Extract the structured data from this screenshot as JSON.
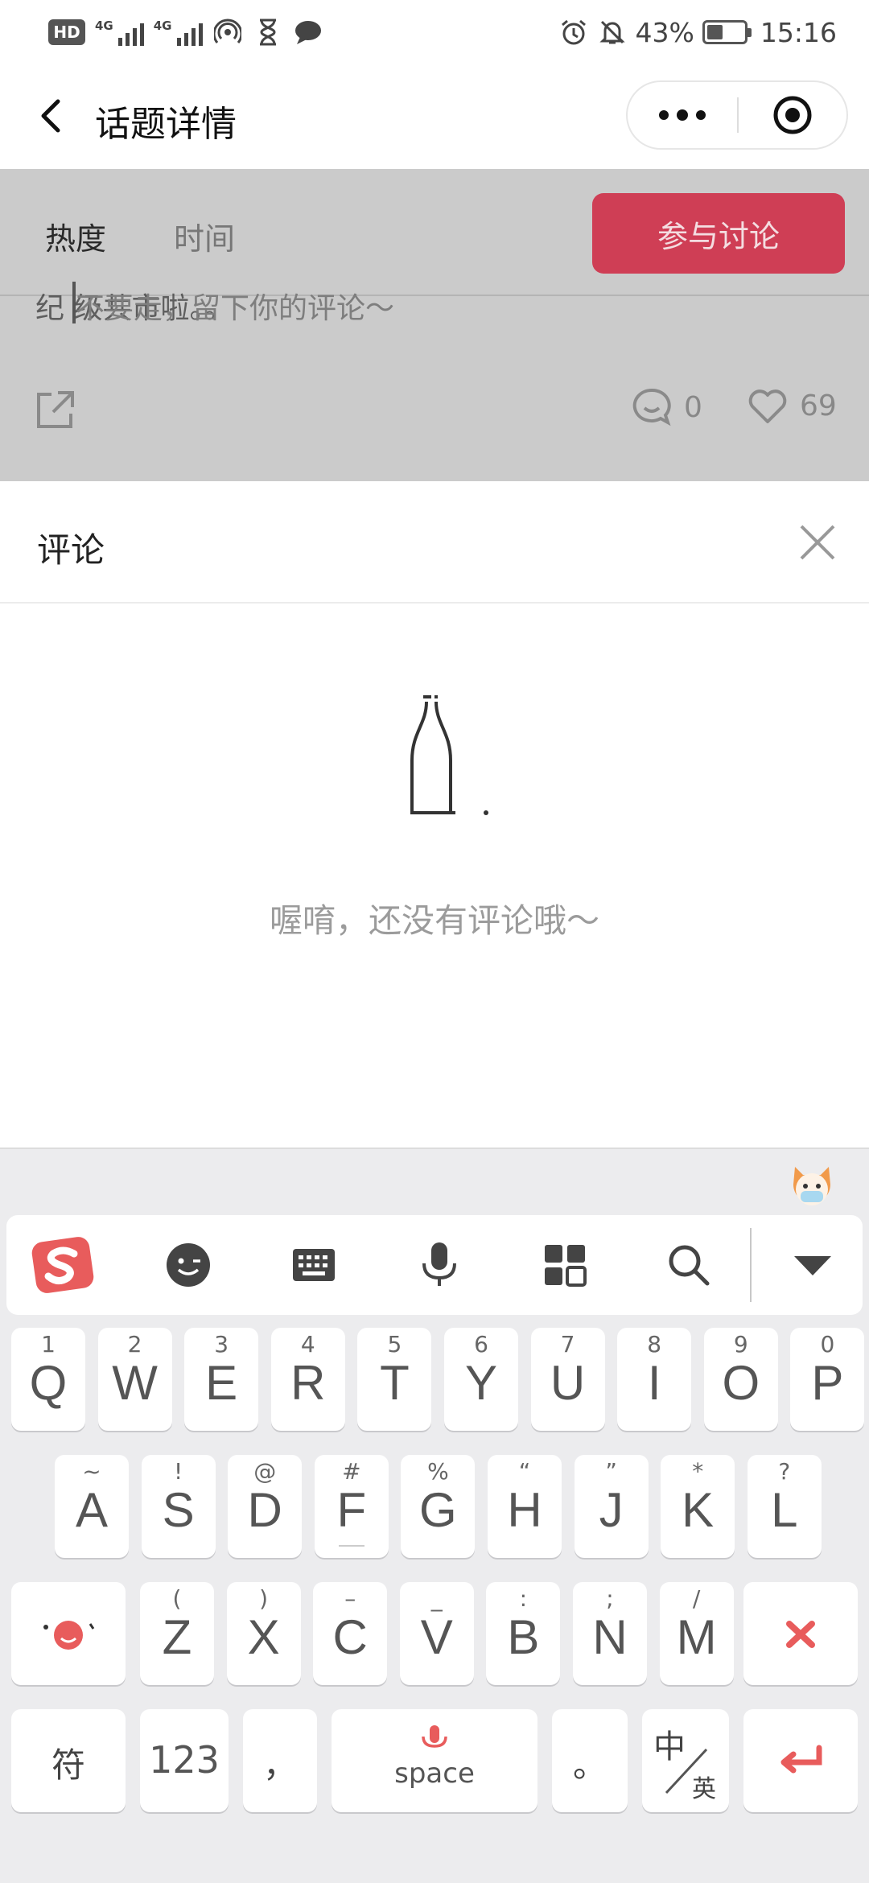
{
  "status": {
    "network_1": "4G",
    "network_2": "4G",
    "battery": "43%",
    "battery_level": 0.43,
    "time": "15:16"
  },
  "header": {
    "title": "话题详情"
  },
  "content": {
    "tab_hot": "热度",
    "tab_time": "时间",
    "join_button": "参与讨论",
    "overlap_text": "纪 级共市啦。。",
    "comment_hint": "不要走，留下你的评论～",
    "comment_count": "0",
    "like_count": "69"
  },
  "comments": {
    "title": "评论",
    "empty_text": "喔唷，还没有评论哦～"
  },
  "keyboard": {
    "row1": [
      {
        "hint": "1",
        "key": "Q"
      },
      {
        "hint": "2",
        "key": "W"
      },
      {
        "hint": "3",
        "key": "E"
      },
      {
        "hint": "4",
        "key": "R"
      },
      {
        "hint": "5",
        "key": "T"
      },
      {
        "hint": "6",
        "key": "Y"
      },
      {
        "hint": "7",
        "key": "U"
      },
      {
        "hint": "8",
        "key": "I"
      },
      {
        "hint": "9",
        "key": "O"
      },
      {
        "hint": "0",
        "key": "P"
      }
    ],
    "row2": [
      {
        "hint": "~",
        "key": "A"
      },
      {
        "hint": "!",
        "key": "S"
      },
      {
        "hint": "@",
        "key": "D"
      },
      {
        "hint": "#",
        "key": "F"
      },
      {
        "hint": "%",
        "key": "G"
      },
      {
        "hint": "“",
        "key": "H"
      },
      {
        "hint": "”",
        "key": "J"
      },
      {
        "hint": "*",
        "key": "K"
      },
      {
        "hint": "?",
        "key": "L"
      }
    ],
    "row3": [
      {
        "hint": "(",
        "key": "Z"
      },
      {
        "hint": ")",
        "key": "X"
      },
      {
        "hint": "–",
        "key": "C"
      },
      {
        "hint": "_",
        "key": "V"
      },
      {
        "hint": ":",
        "key": "B"
      },
      {
        "hint": ";",
        "key": "N"
      },
      {
        "hint": "/",
        "key": "M"
      }
    ],
    "symbols_key": "符",
    "numbers_key": "123",
    "comma_key": "，",
    "space_key": "space",
    "period_key": "。",
    "lang_key_top": "中",
    "lang_key_bottom": "英"
  },
  "colors": {
    "accent": "#cf3e55",
    "sogou_red": "#e85c5c"
  }
}
